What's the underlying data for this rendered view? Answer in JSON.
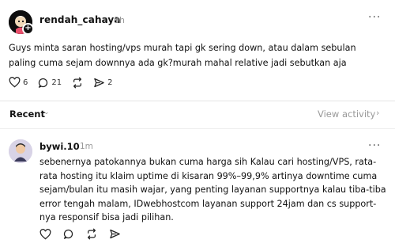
{
  "post": {
    "username": "rendah_cahaya",
    "time": "9h",
    "text": "Guys minta saran hosting/vps murah tapi gk sering down, atau dalam sebulan paling cuma sejam downnya ada gk?murah mahal relative jadi sebutkan aja",
    "likes": "6",
    "replies": "21",
    "shares": "2",
    "more_label": "···"
  },
  "activity_bar": {
    "sort_label": "Recent",
    "sort_chevron": "⌄",
    "view_activity_label": "View activity",
    "view_activity_chevron": "›"
  },
  "reply": {
    "username": "bywi.10",
    "time": "1m",
    "text": "sebenernya patokannya bukan cuma harga sih Kalau cari hosting/VPS, rata-rata hosting itu klaim uptime di kisaran 99%–99,9% artinya downtime cuma sejam/bulan itu masih wajar, yang penting layanan supportnya kalau tiba-tiba error tengah malam, IDwebhostcom layanan support 24jam dan cs support-nya responsif bisa jadi pilihan.",
    "more_label": "···"
  },
  "icons": {
    "like": "heart-icon",
    "reply": "comment-icon",
    "repost": "repost-icon",
    "share": "send-icon",
    "avatar_plus": "+"
  }
}
